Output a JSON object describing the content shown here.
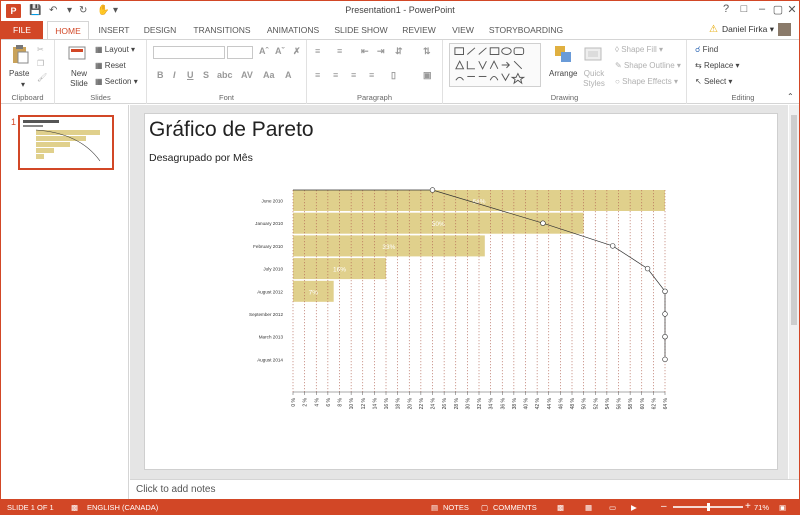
{
  "window": {
    "title": "Presentation1 - PowerPoint",
    "app_logo": "P"
  },
  "tabs": [
    "FILE",
    "HOME",
    "INSERT",
    "DESIGN",
    "TRANSITIONS",
    "ANIMATIONS",
    "SLIDE SHOW",
    "REVIEW",
    "VIEW",
    "STORYBOARDING"
  ],
  "active_tab": "HOME",
  "user": {
    "name": "Daniel Firka",
    "chevron": "▾"
  },
  "ribbon": {
    "clipboard": {
      "label": "Clipboard",
      "paste": "Paste"
    },
    "slides": {
      "label": "Slides",
      "new_slide": "New Slide",
      "layout": "Layout",
      "reset": "Reset",
      "section": "Section"
    },
    "font": {
      "label": "Font"
    },
    "paragraph": {
      "label": "Paragraph"
    },
    "drawing": {
      "label": "Drawing",
      "arrange": "Arrange",
      "quick_styles": "Quick Styles",
      "shape_fill": "Shape Fill",
      "shape_outline": "Shape Outline",
      "shape_effects": "Shape Effects"
    },
    "editing": {
      "label": "Editing",
      "find": "Find",
      "replace": "Replace",
      "select": "Select"
    }
  },
  "slide_pane": {
    "slide_number": "1"
  },
  "slide": {
    "title": "Gráfico de Pareto",
    "subtitle": "Desagrupado por Mês"
  },
  "notes_placeholder": "Click to add notes",
  "status": {
    "slide": "SLIDE 1 OF 1",
    "language": "ENGLISH (CANADA)",
    "notes": "NOTES",
    "comments": "COMMENTS",
    "zoom": "71%"
  },
  "colors": {
    "accent": "#d24726",
    "bar": "#e0d08c",
    "line": "#333333"
  },
  "chart_data": {
    "type": "bar",
    "orientation": "horizontal",
    "title": "",
    "categories": [
      "June 2010",
      "January 2010",
      "February 2010",
      "July 2010",
      "August 2012",
      "September 2012",
      "March 2013",
      "August 2014"
    ],
    "values": [
      64,
      50,
      33,
      16,
      7,
      0,
      0,
      0
    ],
    "bar_labels": [
      "64%",
      "50%",
      "33%",
      "16%",
      "7%",
      "",
      "",
      ""
    ],
    "cumulative_line": [
      24,
      43,
      55,
      61,
      64,
      64,
      64,
      64
    ],
    "xlim": [
      0,
      64
    ],
    "x_ticks": [
      "0 %",
      "2 %",
      "4 %",
      "6 %",
      "8 %",
      "10 %",
      "12 %",
      "14 %",
      "16 %",
      "18 %",
      "20 %",
      "22 %",
      "24 %",
      "26 %",
      "28 %",
      "30 %",
      "32 %",
      "34 %",
      "36 %",
      "38 %",
      "40 %",
      "42 %",
      "44 %",
      "46 %",
      "48 %",
      "50 %",
      "52 %",
      "54 %",
      "56 %",
      "58 %",
      "60 %",
      "62 %",
      "64 %"
    ],
    "grid": true
  }
}
